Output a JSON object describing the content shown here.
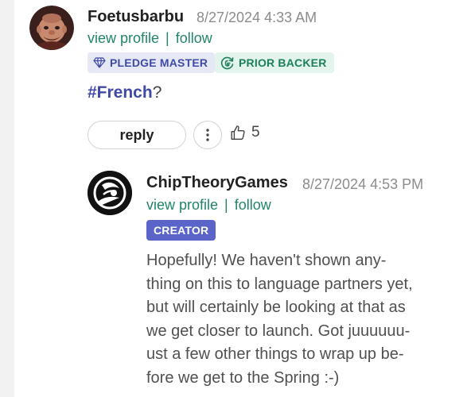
{
  "comments": [
    {
      "author": "Foetusbarbu",
      "timestamp": "8/27/2024 4:33 AM",
      "view_profile": "view profile",
      "separator": "|",
      "follow": "follow",
      "badges": [
        {
          "label": "PLEDGE MASTER",
          "icon": "diamond-icon"
        },
        {
          "label": "PRIOR BACKER",
          "icon": "refresh-g-icon"
        }
      ],
      "text_hashtag": "#French",
      "text_rest": "?",
      "reply_label": "reply",
      "more_icon": "more-vertical-icon",
      "like_icon": "thumbs-up-icon",
      "like_count": "5"
    },
    {
      "author": "ChipTheoryGames",
      "timestamp": "8/27/2024 4:53 PM",
      "view_profile": "view profile",
      "separator": "|",
      "follow": "follow",
      "badges": [
        {
          "label": "CREATOR"
        }
      ],
      "text_lines": [
        "Hopefully! We haven't shown any-",
        "thing on this to language partners yet,",
        "but will certainly be looking at that as",
        "we get closer to launch. Got juuuuuu-",
        "ust a few other things to wrap up be-",
        "fore we get to the Spring :-)"
      ]
    }
  ],
  "colors": {
    "author": "#222222",
    "timestamp": "#8c8c8c",
    "link": "#20856a",
    "hashtag": "#3f4aa5",
    "badge_pledge_bg": "#e6e8f6",
    "badge_prior_bg": "#e2f4ec",
    "badge_creator_bg": "#5b65c9"
  }
}
